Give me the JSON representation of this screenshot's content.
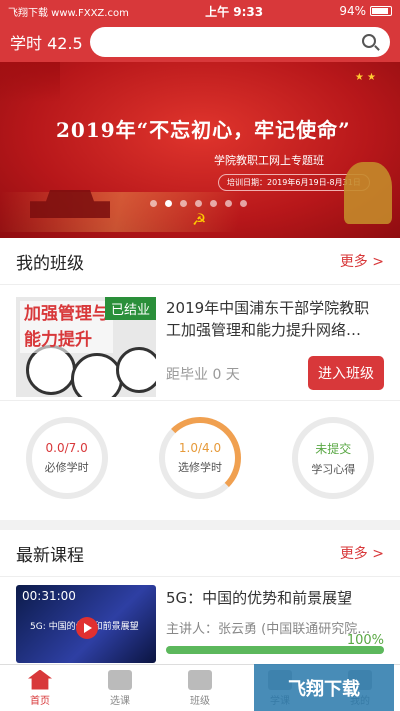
{
  "status_bar": {
    "left": "飞翔下载 www.FXXZ.com",
    "time": "上午 9:33",
    "battery": "94%"
  },
  "header": {
    "credit": "学时 42.5",
    "search_placeholder": ""
  },
  "banner": {
    "title": "2019年“不忘初心，牢记使命”",
    "subtitle": "学院教职工网上专题班",
    "date": "培训日期：2019年6月19日-8月31日",
    "dots": 7,
    "active_dot": 2
  },
  "my_class": {
    "title": "我的班级",
    "more": "更多 >",
    "item": {
      "thumb_text": [
        "加强管理与",
        "能力提升"
      ],
      "badge": "已结业",
      "name": "2019年中国浦东干部学院教职工加强管理和能力提升网络…",
      "remain": "距毕业 0 天",
      "enter": "进入班级"
    },
    "stats": [
      {
        "value": "0.0/7.0",
        "label": "必修学时"
      },
      {
        "value": "1.0/4.0",
        "label": "选修学时"
      },
      {
        "value": "未提交",
        "label": "学习心得"
      }
    ]
  },
  "latest_courses": {
    "title": "最新课程",
    "more": "更多 >",
    "item": {
      "duration": "00:31:00",
      "thumb_text": "5G: 中国的优势和前景展望",
      "name": "5G：中国的优势和前景展望",
      "speaker": "主讲人：张云勇 (中国联通研究院…",
      "progress": 100,
      "progress_text": "100%"
    }
  },
  "tabbar": [
    {
      "label": "首页"
    },
    {
      "label": "选课"
    },
    {
      "label": "班级"
    },
    {
      "label": "学课"
    },
    {
      "label": "我的"
    }
  ],
  "watermark": "飞翔下载",
  "colors": {
    "accent": "#d8383a",
    "green": "#5aa845",
    "orange": "#f0a050"
  }
}
